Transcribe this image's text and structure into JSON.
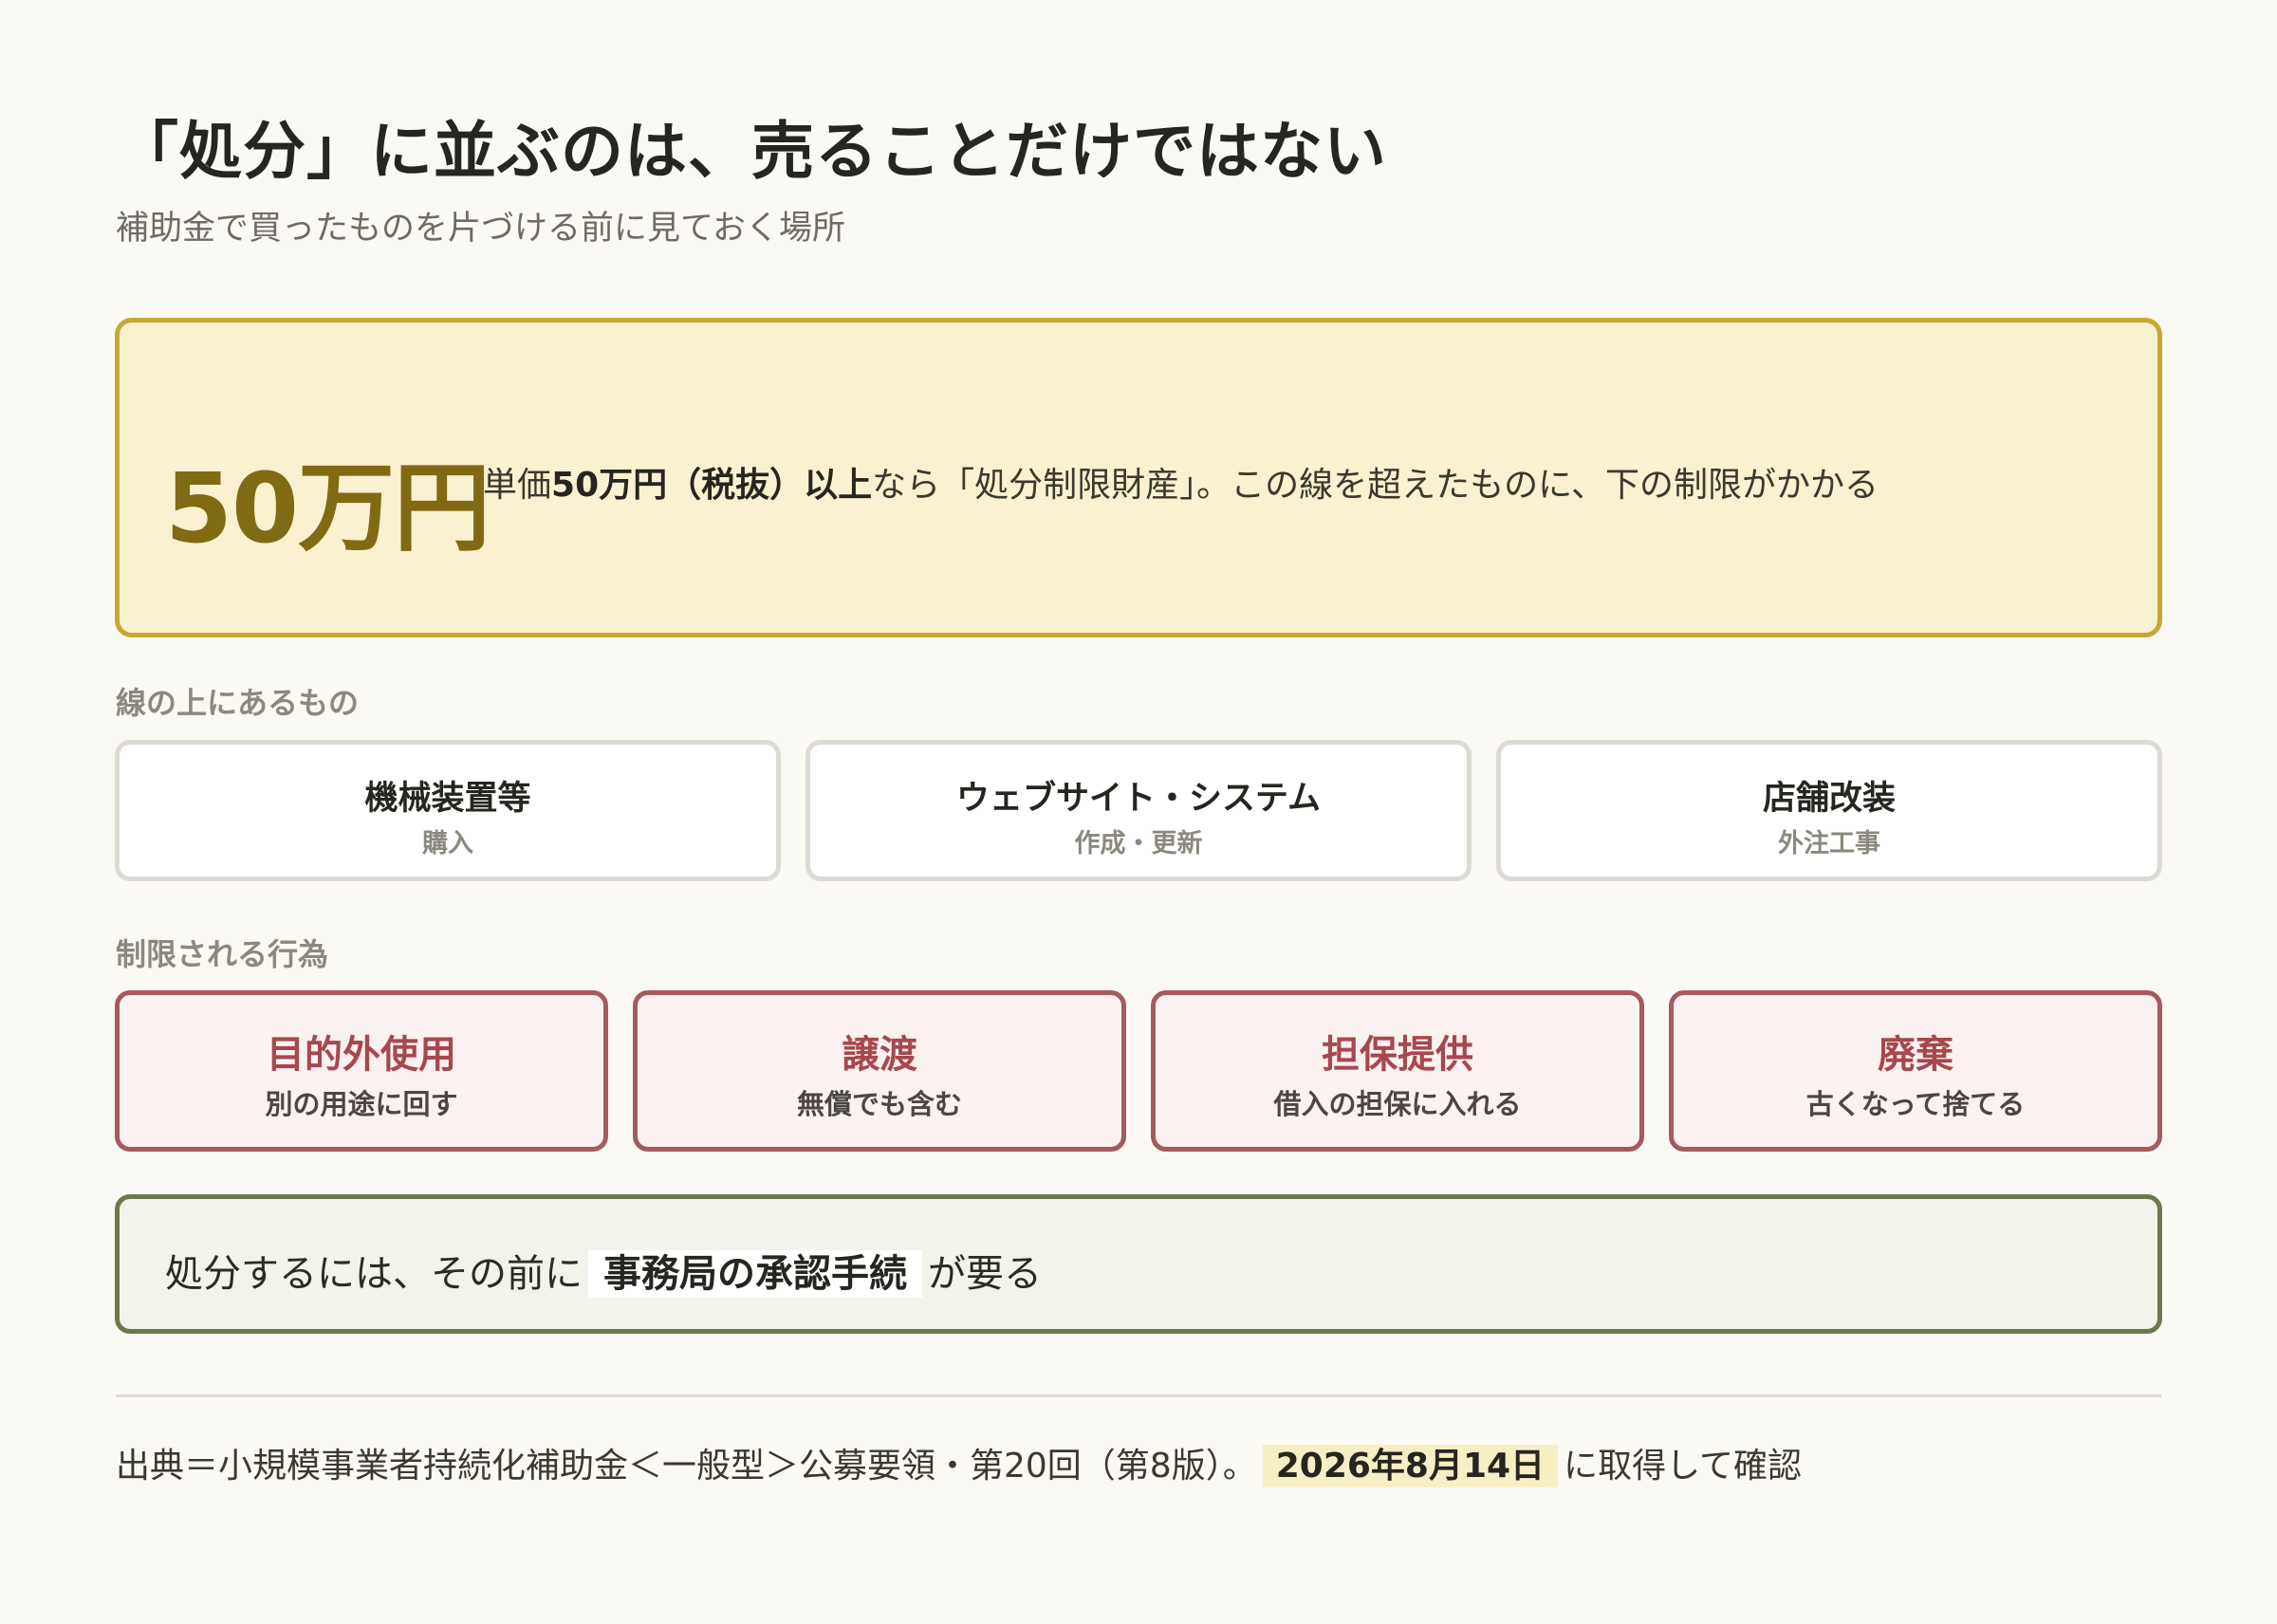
{
  "header": {
    "title": "「処分」に並ぶのは、売ることだけではない",
    "subtitle": "補助金で買ったものを片づける前に見ておく場所"
  },
  "threshold": {
    "amount": "50万円",
    "text_prefix": "単価",
    "text_bold": "50万円（税抜）以上",
    "text_suffix": "なら「処分制限財産」。この線を超えたものに、下の制限がかかる"
  },
  "items_section": {
    "label": "線の上にあるもの",
    "items": [
      {
        "name": "機械装置等",
        "sub": "購入"
      },
      {
        "name": "ウェブサイト・システム",
        "sub": "作成・更新"
      },
      {
        "name": "店舗改装",
        "sub": "外注工事"
      }
    ]
  },
  "restrictions_section": {
    "label": "制限される行為",
    "items": [
      {
        "name": "目的外使用",
        "sub": "別の用途に回す"
      },
      {
        "name": "譲渡",
        "sub": "無償でも含む"
      },
      {
        "name": "担保提供",
        "sub": "借入の担保に入れる"
      },
      {
        "name": "廃棄",
        "sub": "古くなって捨てる"
      }
    ]
  },
  "approval": {
    "prefix": "処分するには、その前に",
    "highlight": "事務局の承認手続",
    "suffix": "が要る"
  },
  "source": {
    "prefix": "出典＝小規模事業者持続化補助金＜一般型＞公募要領・第20回（第8版）。",
    "date": "2026年8月14日",
    "suffix": "に取得して確認"
  },
  "colors": {
    "background": "#faf9f4",
    "threshold_fill": "#f9f1cf",
    "threshold_border": "#c9a634",
    "threshold_amount": "#806a14",
    "restriction_border": "#a65a5e",
    "restriction_text": "#a7484d",
    "approval_border": "#6a7a4c"
  }
}
